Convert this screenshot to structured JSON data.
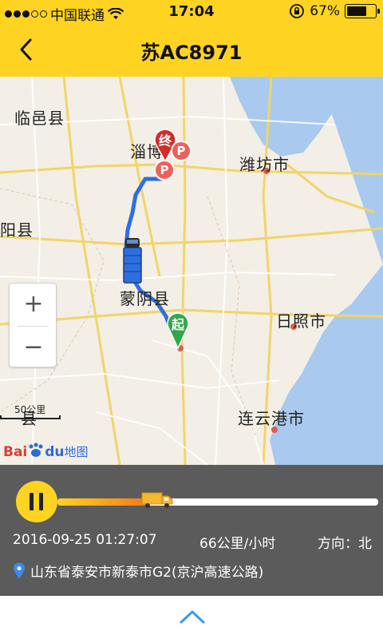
{
  "status_bar": {
    "carrier": "中国联通",
    "time": "17:04",
    "battery": "67%",
    "battery_level": 0.67
  },
  "nav": {
    "title": "苏AC8971"
  },
  "map": {
    "labels": {
      "linyi": "临邑县",
      "zibo": "淄博",
      "weifang": "潍坊市",
      "yang": "阳县",
      "mengyin": "蒙阴县",
      "rizhao": "日照市",
      "lianyungang": "连云港市",
      "xian": "县"
    },
    "start_marker": "起",
    "end_marker": "终",
    "parking_marker": "P",
    "zoom_in": "+",
    "zoom_out": "−",
    "scale": "50公里",
    "logo_bai": "Bai",
    "logo_du": "du",
    "logo_map": "地图"
  },
  "player": {
    "progress": 0.28,
    "datetime": "2016-09-25 01:27:07",
    "speed": "66公里/小时",
    "direction": "方向：北",
    "address": "山东省泰安市新泰市G2(京沪高速公路)"
  },
  "colors": {
    "accent": "#FFD322",
    "route": "#2E6FE0",
    "panel": "#5B5B5B"
  }
}
